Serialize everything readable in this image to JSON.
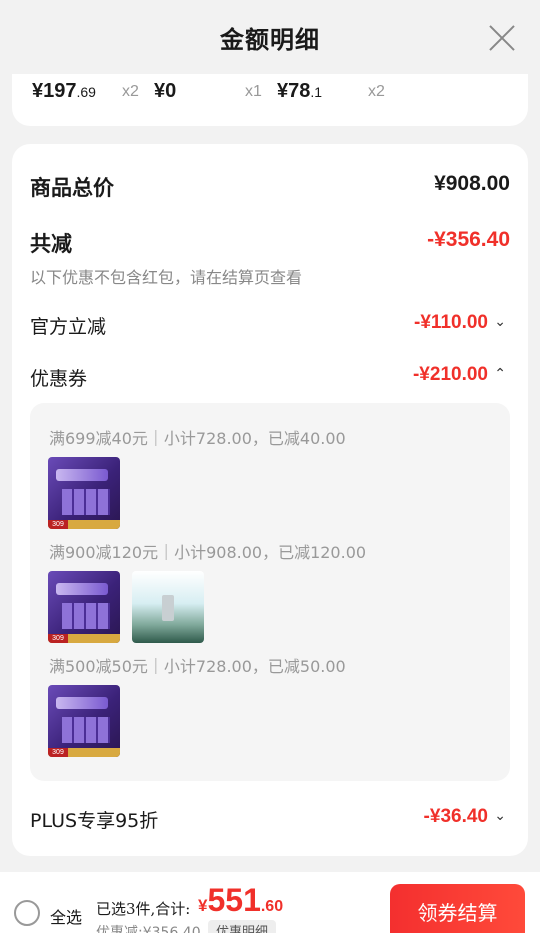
{
  "header": {
    "title": "金额明细"
  },
  "top_items": [
    {
      "price_int": "¥197",
      "price_dec": ".69",
      "qty": "x2"
    },
    {
      "price_int": "¥0",
      "price_dec": "",
      "qty": "x1"
    },
    {
      "price_int": "¥78",
      "price_dec": ".1",
      "qty": "x2"
    }
  ],
  "summary": {
    "total_label": "商品总价",
    "total_value": "¥908.00",
    "reduce_label": "共减",
    "reduce_value": "-¥356.40",
    "note": "以下优惠不包含红包，请在结算页查看"
  },
  "discounts": [
    {
      "label": "官方立减",
      "value": "-¥110.00",
      "chevron": "⌄",
      "icon": "chevron-down-icon"
    },
    {
      "label": "优惠券",
      "value": "-¥210.00",
      "chevron": "⌃",
      "icon": "chevron-up-icon"
    },
    {
      "label": "PLUS专享95折",
      "value": "-¥36.40",
      "chevron": "⌄",
      "icon": "chevron-down-icon"
    }
  ],
  "coupons": [
    {
      "text": "满699减40元｜小计728.00，已减40.00",
      "products": [
        "product-purple-serum"
      ]
    },
    {
      "text": "满900减120元｜小计908.00，已减120.00",
      "products": [
        "product-purple-serum",
        "product-bottle-scene"
      ]
    },
    {
      "text": "满500减50元｜小计728.00，已减50.00",
      "products": [
        "product-purple-serum"
      ]
    }
  ],
  "product_tag": "309",
  "footer": {
    "select_all": "全选",
    "selected_summary": "已选3件,合计:",
    "total_currency": "¥",
    "total_int": "551",
    "total_dec": ".60",
    "discount_sub": "优惠减:¥356.40",
    "detail_button": "优惠明细",
    "checkout_button": "领券结算"
  },
  "colors": {
    "accent_red": "#f0302a",
    "background": "#f2f2f2"
  }
}
